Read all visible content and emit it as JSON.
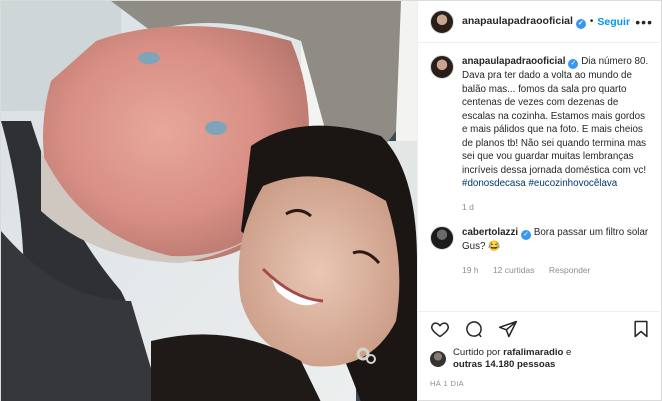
{
  "post": {
    "author": "anapaulapadraooficial",
    "follow_label": "Seguir",
    "dot": "•",
    "more_label": "•••",
    "caption": {
      "text": "Dia número 80. Dava pra ter dado a volta ao mundo de balão mas... fomos da sala pro quarto centenas de vezes com dezenas de escalas na cozinha. Estamos mais gordos e mais pálidos que na foto. E mais cheios de planos tb! Não sei quando termina mas sei que vou guardar muitas lembranças incríveis dessa jornada doméstica com vc! ",
      "hashtags": "#donosdecasa #eucozinhovocêlava",
      "age": "1 d"
    },
    "reply": {
      "user": "cabertolazzi",
      "text": "Bora passar um filtro solar Gus? 😂",
      "age": "19 h",
      "likes": "12 curtidas",
      "reply_label": "Responder"
    },
    "liked_by": {
      "prefix": "Curtido por ",
      "user": "rafalimaradio",
      "and": " e",
      "others": "outras 14.180 pessoas"
    },
    "posted_ago": "HÁ 1 DIA"
  },
  "icons": {
    "verified": "verified-badge-icon",
    "like": "heart-icon",
    "comment": "comment-icon",
    "share": "paper-plane-icon",
    "save": "bookmark-icon",
    "options": "more-options-icon"
  },
  "colors": {
    "link": "#0095f6",
    "verified": "#3897f0",
    "muted": "#8e8e8e",
    "hashtag": "#00376b"
  }
}
